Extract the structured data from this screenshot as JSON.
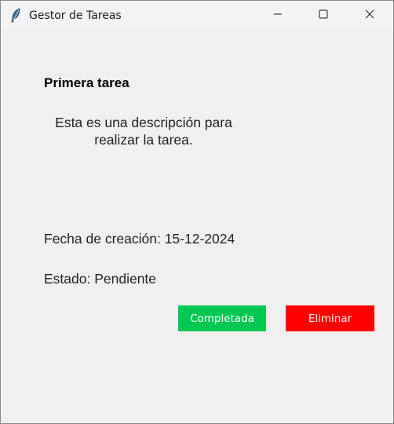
{
  "window": {
    "title": "Gestor de Tareas",
    "icon": "feather-icon",
    "controls": [
      "minimize-icon",
      "maximize-icon",
      "close-icon"
    ]
  },
  "task": {
    "title": "Primera tarea",
    "description": "Esta es una descripción para realizar la tarea.",
    "date": "Fecha de creación: 15-12-2024",
    "status": "Estado: Pendiente"
  },
  "buttons": {
    "complete_label": "Completada",
    "delete_label": "Eliminar"
  },
  "colors": {
    "complete": "#00c853",
    "delete": "#ff0000",
    "background": "#f0f0f0"
  }
}
